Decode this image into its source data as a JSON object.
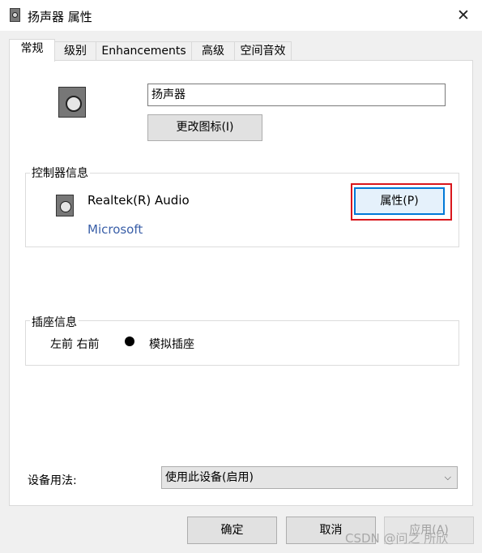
{
  "window": {
    "title": "扬声器 属性",
    "close_symbol": "✕"
  },
  "tabs": [
    {
      "label": "常规",
      "active": true
    },
    {
      "label": "级别",
      "active": false
    },
    {
      "label": "Enhancements",
      "active": false
    },
    {
      "label": "高级",
      "active": false
    },
    {
      "label": "空间音效",
      "active": false
    }
  ],
  "general": {
    "device_icon": "speaker-icon",
    "name_value": "扬声器",
    "change_icon_label": "更改图标(I)"
  },
  "controller": {
    "group_label": "控制器信息",
    "icon": "speaker-icon",
    "name": "Realtek(R) Audio",
    "vendor": "Microsoft",
    "properties_label": "属性(P)"
  },
  "jack": {
    "group_label": "插座信息",
    "location": "左前 右前",
    "dot_color": "#000000",
    "type": "模拟插座"
  },
  "usage": {
    "label": "设备用法:",
    "selected": "使用此设备(启用)",
    "chevron_icon": "chevron-down-icon"
  },
  "buttons": {
    "ok": "确定",
    "cancel": "取消",
    "apply": "应用(A)"
  },
  "watermark": "CSDN @问之 所欣",
  "colors": {
    "highlight": "#d9161c",
    "focus": "#0078d7",
    "link": "#3a5fa8"
  }
}
